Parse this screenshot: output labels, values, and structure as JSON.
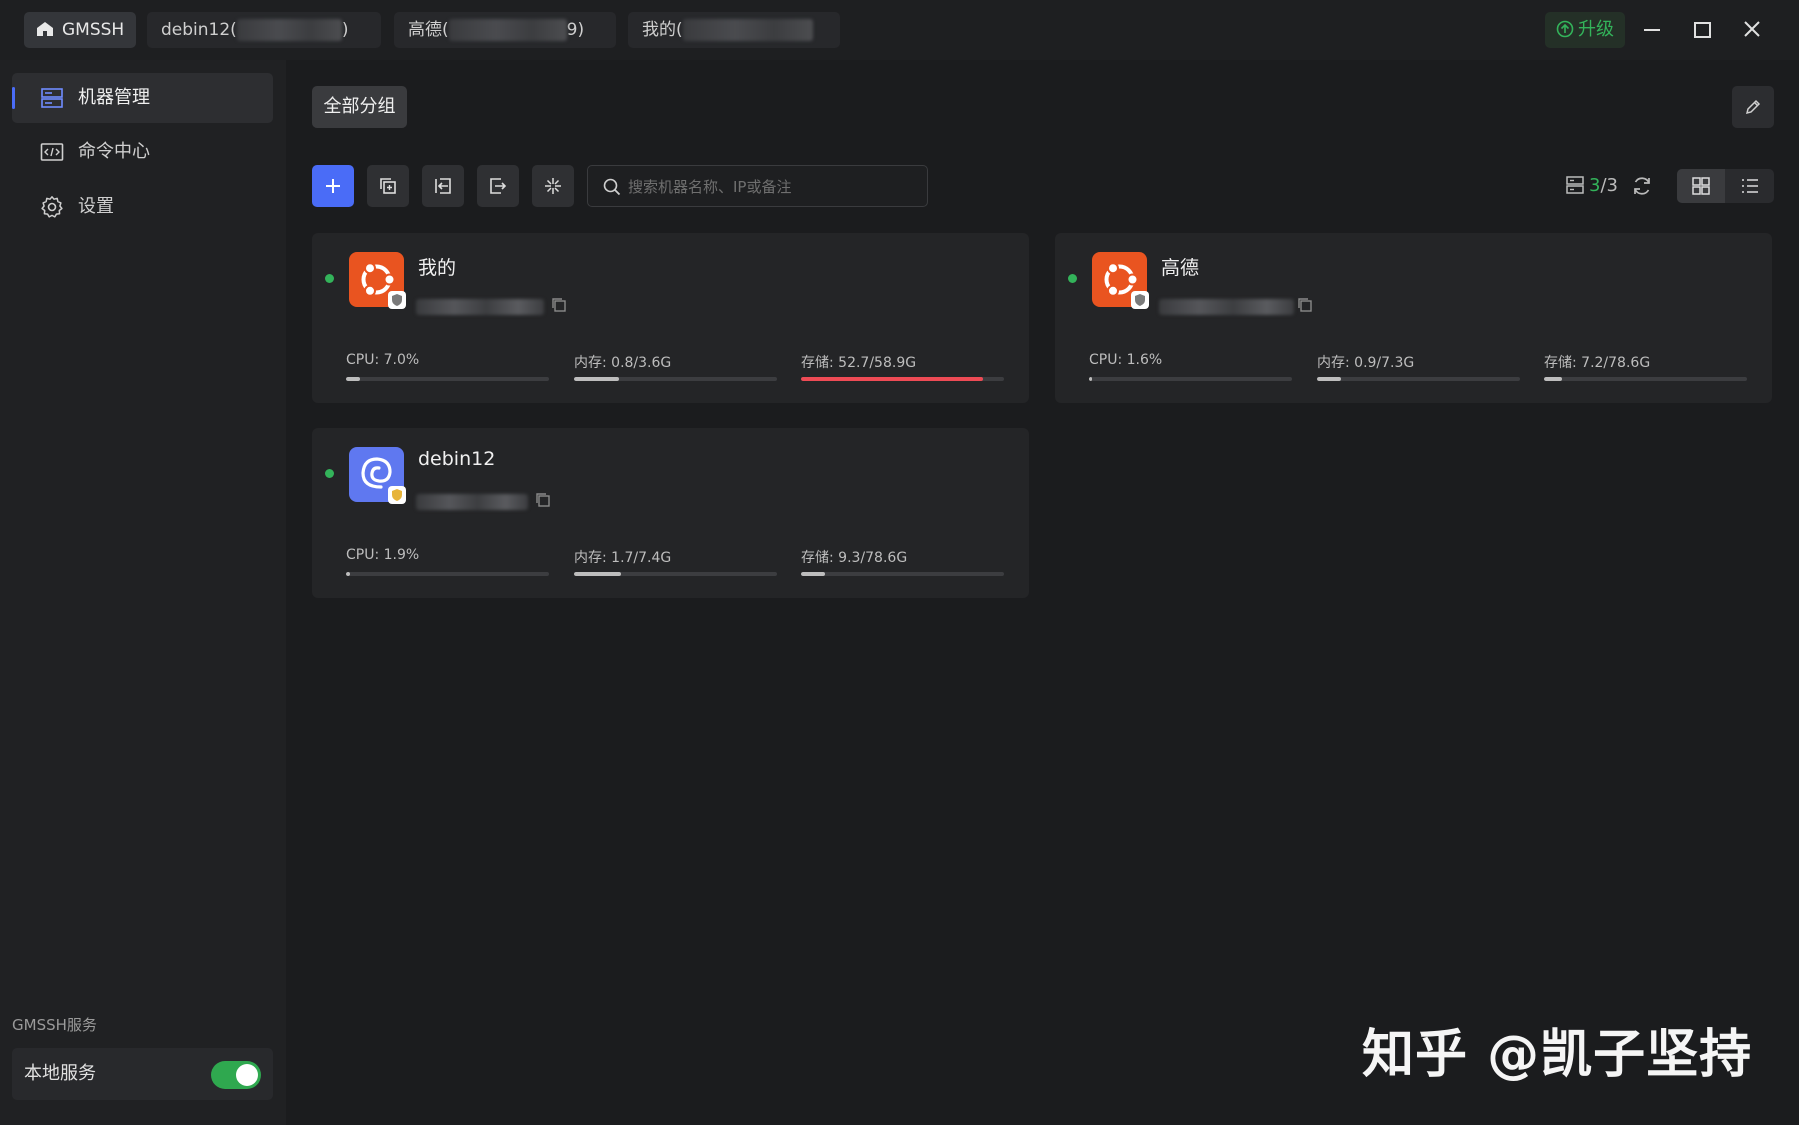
{
  "titlebar": {
    "tabs": [
      {
        "label": "GMSSH",
        "icon": "home-icon"
      },
      {
        "label": "debin12(",
        "suffix": ")"
      },
      {
        "label": "高德(",
        "suffix": "9)"
      },
      {
        "label": "我的("
      }
    ],
    "upgrade_label": "升级",
    "upgrade_color": "#33b35a"
  },
  "sidebar": {
    "items": [
      {
        "label": "机器管理",
        "icon": "server-list-icon",
        "active": true
      },
      {
        "label": "命令中心",
        "icon": "terminal-code-icon"
      },
      {
        "label": "设置",
        "icon": "gear-icon"
      }
    ],
    "service_title": "GMSSH服务",
    "service_label": "本地服务",
    "service_enabled": true
  },
  "main": {
    "group_label": "全部分组",
    "search_placeholder": "搜索机器名称、IP或备注",
    "count_current": "3",
    "count_total": "/3",
    "accent": "#4a6cf7"
  },
  "machines": [
    {
      "name": "我的",
      "os": "ubuntu",
      "online": true,
      "cpu": "CPU:  7.0%",
      "cpu_pct": 7.0,
      "mem": "内存:  0.8/3.6G",
      "mem_pct": 22,
      "disk": "存储:  52.7/58.9G",
      "disk_pct": 89.5
    },
    {
      "name": "高德",
      "os": "ubuntu",
      "online": true,
      "cpu": "CPU:  1.6%",
      "cpu_pct": 1.6,
      "mem": "内存:  0.9/7.3G",
      "mem_pct": 12,
      "disk": "存储:  7.2/78.6G",
      "disk_pct": 9
    },
    {
      "name": "debin12",
      "os": "debian",
      "online": true,
      "cpu": "CPU:  1.9%",
      "cpu_pct": 1.9,
      "mem": "内存:  1.7/7.4G",
      "mem_pct": 23,
      "disk": "存储:  9.3/78.6G",
      "disk_pct": 12
    }
  ],
  "watermark": "知乎 @凯子坚持"
}
